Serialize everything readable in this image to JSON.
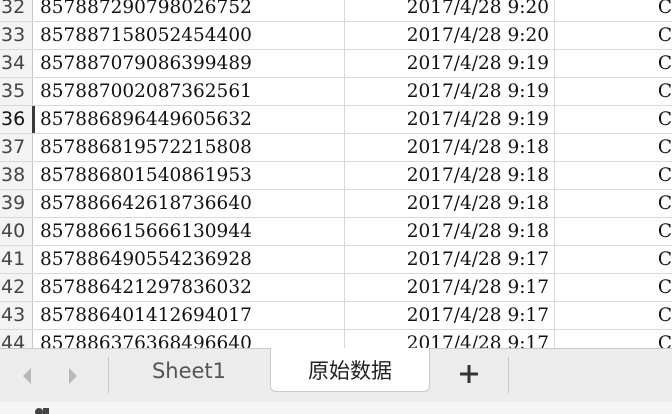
{
  "rows": [
    {
      "num": "32",
      "id": "857887290798026752",
      "time": "2017/4/28  9:20",
      "next": "C"
    },
    {
      "num": "33",
      "id": "857887158052454400",
      "time": "2017/4/28  9:20",
      "next": "C"
    },
    {
      "num": "34",
      "id": "857887079086399489",
      "time": "2017/4/28  9:19",
      "next": "C"
    },
    {
      "num": "35",
      "id": "857887002087362561",
      "time": "2017/4/28  9:19",
      "next": "C"
    },
    {
      "num": "36",
      "id": "857886896449605632",
      "time": "2017/4/28  9:19",
      "next": "C"
    },
    {
      "num": "37",
      "id": "857886819572215808",
      "time": "2017/4/28  9:18",
      "next": "C"
    },
    {
      "num": "38",
      "id": "857886801540861953",
      "time": "2017/4/28  9:18",
      "next": "C"
    },
    {
      "num": "39",
      "id": "857886642618736640",
      "time": "2017/4/28  9:18",
      "next": "C"
    },
    {
      "num": "40",
      "id": "857886615666130944",
      "time": "2017/4/28  9:18",
      "next": "C"
    },
    {
      "num": "41",
      "id": "857886490554236928",
      "time": "2017/4/28  9:17",
      "next": "C"
    },
    {
      "num": "42",
      "id": "857886421297836032",
      "time": "2017/4/28  9:17",
      "next": "C"
    },
    {
      "num": "43",
      "id": "857886401412694017",
      "time": "2017/4/28  9:17",
      "next": "C"
    },
    {
      "num": "44",
      "id": "857886376368496640",
      "time": "2017/4/28  9:17",
      "next": "C"
    }
  ],
  "active_row": "36",
  "tabs": [
    {
      "label": "Sheet1",
      "active": false
    },
    {
      "label": "原始数据",
      "active": true
    }
  ],
  "add_sheet_label": "+",
  "icons": {
    "prev": "chevron-left-icon",
    "next": "chevron-right-icon",
    "add": "plus-icon",
    "status": "status-icon"
  },
  "colors": {
    "gridline": "#d9d9d9",
    "header_bg": "#f3f3f3",
    "tabbar_bg": "#ececec",
    "text": "#111111"
  }
}
